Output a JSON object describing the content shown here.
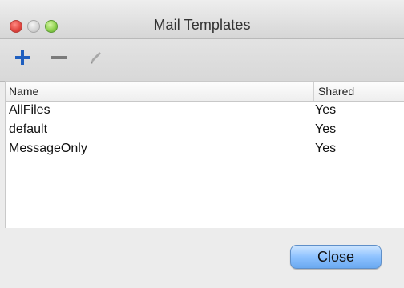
{
  "window": {
    "title": "Mail Templates"
  },
  "toolbar": {
    "buttons": [
      {
        "name": "add",
        "icon": "plus-icon",
        "color": "#1f5fbf"
      },
      {
        "name": "remove",
        "icon": "minus-icon",
        "color": "#7b7b7b"
      },
      {
        "name": "edit",
        "icon": "pencil-icon",
        "color": "#a8a8a8"
      }
    ]
  },
  "table": {
    "columns": [
      "Name",
      "Shared"
    ],
    "rows": [
      {
        "name": "AllFiles",
        "shared": "Yes"
      },
      {
        "name": "default",
        "shared": "Yes"
      },
      {
        "name": "MessageOnly",
        "shared": "Yes"
      }
    ]
  },
  "buttons": {
    "close": "Close"
  }
}
